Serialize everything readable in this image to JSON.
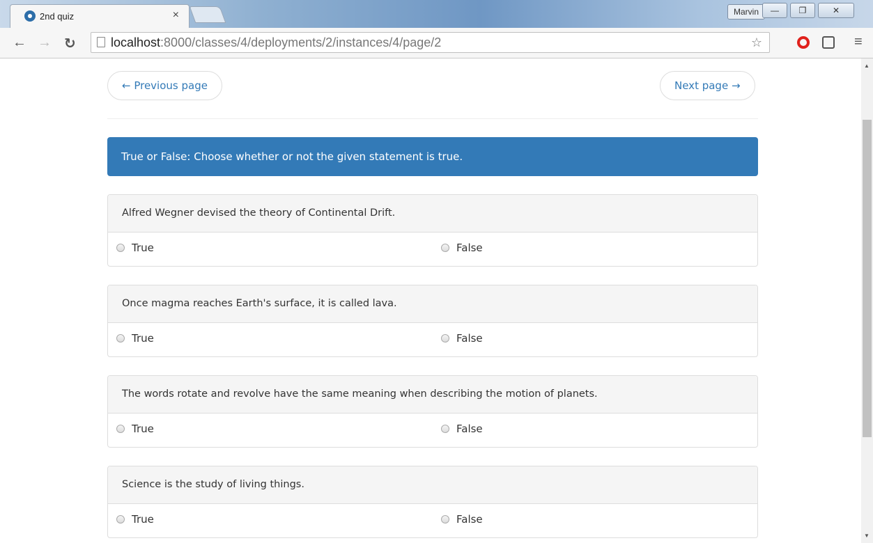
{
  "browser": {
    "tab_title": "2nd quiz",
    "tab_close": "×",
    "user_name": "Marvin",
    "url_host": "localhost",
    "url_path": ":8000/classes/4/deployments/2/instances/4/page/2"
  },
  "pager": {
    "previous_label": "← Previous page",
    "next_label": "Next page →"
  },
  "instructions": "True or False: Choose whether or not the given statement is true.",
  "questions": [
    {
      "text": "Alfred Wegner devised the theory of Continental Drift.",
      "true_label": "True",
      "false_label": "False"
    },
    {
      "text": "Once magma reaches Earth's surface, it is called lava.",
      "true_label": "True",
      "false_label": "False"
    },
    {
      "text": "The words rotate and revolve have the same meaning when describing the motion of planets.",
      "true_label": "True",
      "false_label": "False"
    },
    {
      "text": "Science is the study of living things.",
      "true_label": "True",
      "false_label": "False"
    }
  ]
}
